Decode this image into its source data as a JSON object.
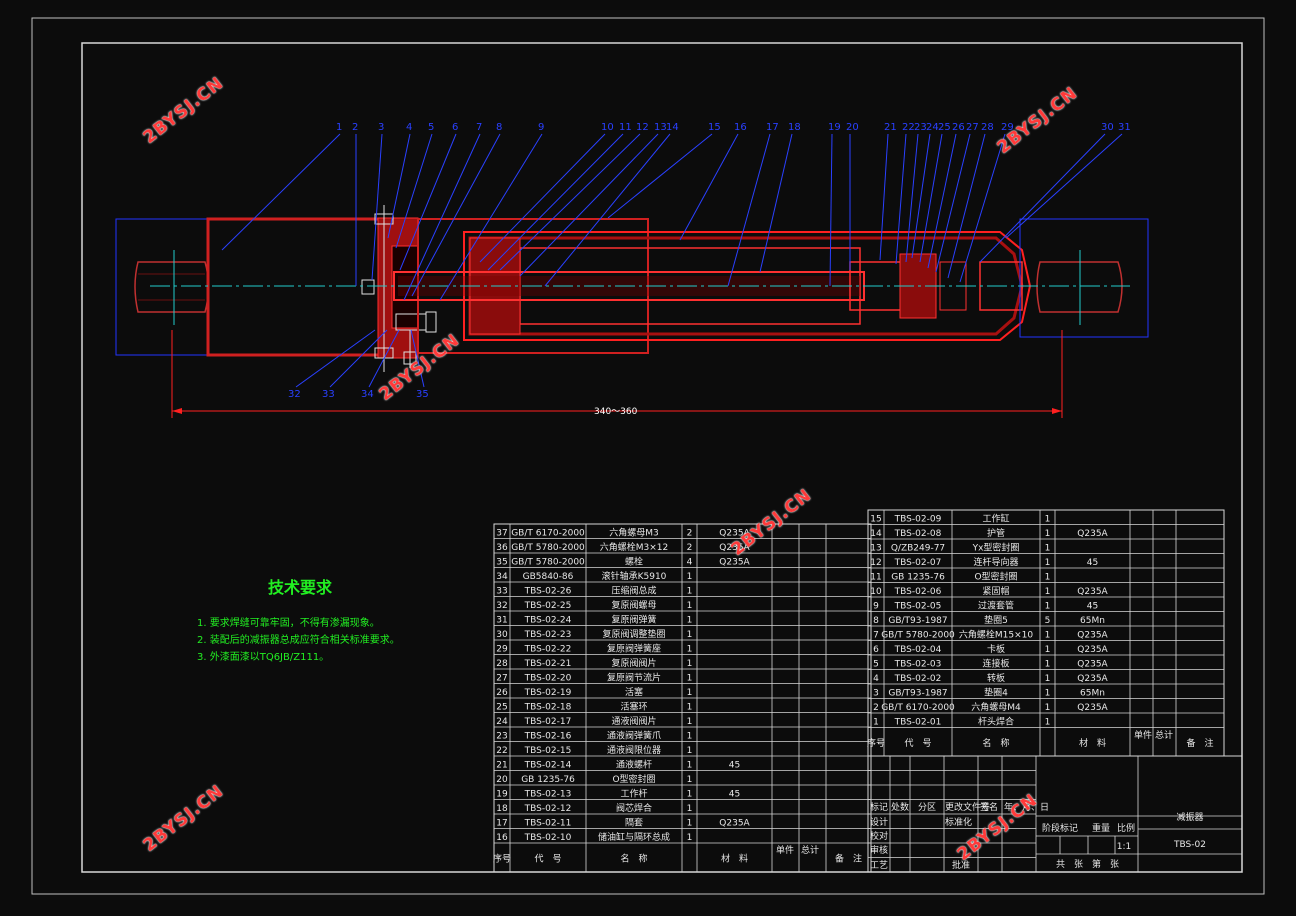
{
  "requirements": {
    "title": "技术要求",
    "items": [
      "1. 要求焊缝可靠牢固，不得有渗漏现象。",
      "2. 装配后的减振器总成应符合相关标准要求。",
      "3. 外漆面漆以TQ6JB/Z111。"
    ]
  },
  "dimension": "340～360",
  "watermark": "2BYSJ.CN",
  "balloons_top": [
    "1",
    "2",
    "3",
    "4",
    "5",
    "6",
    "7",
    "8",
    "9",
    "10",
    "11",
    "12",
    "13",
    "14",
    "15",
    "16",
    "17",
    "18",
    "19",
    "20",
    "21",
    "22",
    "23",
    "24",
    "25",
    "26",
    "27",
    "28",
    "29",
    "30",
    "31"
  ],
  "balloons_bottom": [
    "32",
    "33",
    "34",
    "35"
  ],
  "bom_left": [
    {
      "no": "37",
      "code": "GB/T 6170-2000",
      "name": "六角螺母M3",
      "qty": "2",
      "mat": "Q235A"
    },
    {
      "no": "36",
      "code": "GB/T 5780-2000",
      "name": "六角螺栓M3×12",
      "qty": "2",
      "mat": "Q235A"
    },
    {
      "no": "35",
      "code": "GB/T 5780-2000",
      "name": "螺栓",
      "qty": "4",
      "mat": "Q235A"
    },
    {
      "no": "34",
      "code": "GB5840-86",
      "name": "滚针轴承K5910",
      "qty": "1",
      "mat": ""
    },
    {
      "no": "33",
      "code": "TBS-02-26",
      "name": "压缩阀总成",
      "qty": "1",
      "mat": ""
    },
    {
      "no": "32",
      "code": "TBS-02-25",
      "name": "复原阀螺母",
      "qty": "1",
      "mat": ""
    },
    {
      "no": "31",
      "code": "TBS-02-24",
      "name": "复原阀弹簧",
      "qty": "1",
      "mat": ""
    },
    {
      "no": "30",
      "code": "TBS-02-23",
      "name": "复原阀调整垫圈",
      "qty": "1",
      "mat": ""
    },
    {
      "no": "29",
      "code": "TBS-02-22",
      "name": "复原阀弹簧座",
      "qty": "1",
      "mat": ""
    },
    {
      "no": "28",
      "code": "TBS-02-21",
      "name": "复原阀阀片",
      "qty": "1",
      "mat": ""
    },
    {
      "no": "27",
      "code": "TBS-02-20",
      "name": "复原阀节流片",
      "qty": "1",
      "mat": ""
    },
    {
      "no": "26",
      "code": "TBS-02-19",
      "name": "活塞",
      "qty": "1",
      "mat": ""
    },
    {
      "no": "25",
      "code": "TBS-02-18",
      "name": "活塞环",
      "qty": "1",
      "mat": ""
    },
    {
      "no": "24",
      "code": "TBS-02-17",
      "name": "通液阀阀片",
      "qty": "1",
      "mat": ""
    },
    {
      "no": "23",
      "code": "TBS-02-16",
      "name": "通液阀弹簧爪",
      "qty": "1",
      "mat": ""
    },
    {
      "no": "22",
      "code": "TBS-02-15",
      "name": "通液阀限位器",
      "qty": "1",
      "mat": ""
    },
    {
      "no": "21",
      "code": "TBS-02-14",
      "name": "通液螺杆",
      "qty": "1",
      "mat": "45"
    },
    {
      "no": "20",
      "code": "GB 1235-76",
      "name": "O型密封圈",
      "qty": "1",
      "mat": ""
    },
    {
      "no": "19",
      "code": "TBS-02-13",
      "name": "工作杆",
      "qty": "1",
      "mat": "45"
    },
    {
      "no": "18",
      "code": "TBS-02-12",
      "name": "阀芯焊合",
      "qty": "1",
      "mat": ""
    },
    {
      "no": "17",
      "code": "TBS-02-11",
      "name": "隔套",
      "qty": "1",
      "mat": "Q235A"
    },
    {
      "no": "16",
      "code": "TBS-02-10",
      "name": "储油缸与隔环总成",
      "qty": "1",
      "mat": ""
    }
  ],
  "bom_right": [
    {
      "no": "15",
      "code": "TBS-02-09",
      "name": "工作缸",
      "qty": "1",
      "mat": ""
    },
    {
      "no": "14",
      "code": "TBS-02-08",
      "name": "护管",
      "qty": "1",
      "mat": "Q235A"
    },
    {
      "no": "13",
      "code": "Q/ZB249-77",
      "name": "Yx型密封圈",
      "qty": "1",
      "mat": ""
    },
    {
      "no": "12",
      "code": "TBS-02-07",
      "name": "连杆导向器",
      "qty": "1",
      "mat": "45"
    },
    {
      "no": "11",
      "code": "GB 1235-76",
      "name": "O型密封圈",
      "qty": "1",
      "mat": ""
    },
    {
      "no": "10",
      "code": "TBS-02-06",
      "name": "紧固帽",
      "qty": "1",
      "mat": "Q235A"
    },
    {
      "no": "9",
      "code": "TBS-02-05",
      "name": "过渡套管",
      "qty": "1",
      "mat": "45"
    },
    {
      "no": "8",
      "code": "GB/T93-1987",
      "name": "垫圈5",
      "qty": "5",
      "mat": "65Mn"
    },
    {
      "no": "7",
      "code": "GB/T 5780-2000",
      "name": "六角螺栓M15×10",
      "qty": "1",
      "mat": "Q235A"
    },
    {
      "no": "6",
      "code": "TBS-02-04",
      "name": "卡板",
      "qty": "1",
      "mat": "Q235A"
    },
    {
      "no": "5",
      "code": "TBS-02-03",
      "name": "连接板",
      "qty": "1",
      "mat": "Q235A"
    },
    {
      "no": "4",
      "code": "TBS-02-02",
      "name": "转板",
      "qty": "1",
      "mat": "Q235A"
    },
    {
      "no": "3",
      "code": "GB/T93-1987",
      "name": "垫圈4",
      "qty": "1",
      "mat": "65Mn"
    },
    {
      "no": "2",
      "code": "GB/T 6170-2000",
      "name": "六角螺母M4",
      "qty": "1",
      "mat": "Q235A"
    },
    {
      "no": "1",
      "code": "TBS-02-01",
      "name": "杆头焊合",
      "qty": "1",
      "mat": ""
    }
  ],
  "headers": {
    "no": "序号",
    "code": "代　号",
    "name": "名　称",
    "mat": "材　料",
    "unit": "单件",
    "total": "总计",
    "weight_suffix": "重量",
    "note": "备　注"
  },
  "titleblock": {
    "title": "减振器",
    "drawing_no": "TBS-02",
    "scale": "1:1",
    "stage": "阶段标记",
    "weight": "重量",
    "ratio": "比例",
    "sheets": "共　张　第　张",
    "rows": [
      "标记",
      "处数",
      "分区",
      "更改文件号",
      "签名",
      "年、月、日"
    ],
    "design": "设计",
    "standard": "标准化",
    "check": "校对",
    "review": "审核",
    "process": "工艺",
    "approve": "批准"
  }
}
